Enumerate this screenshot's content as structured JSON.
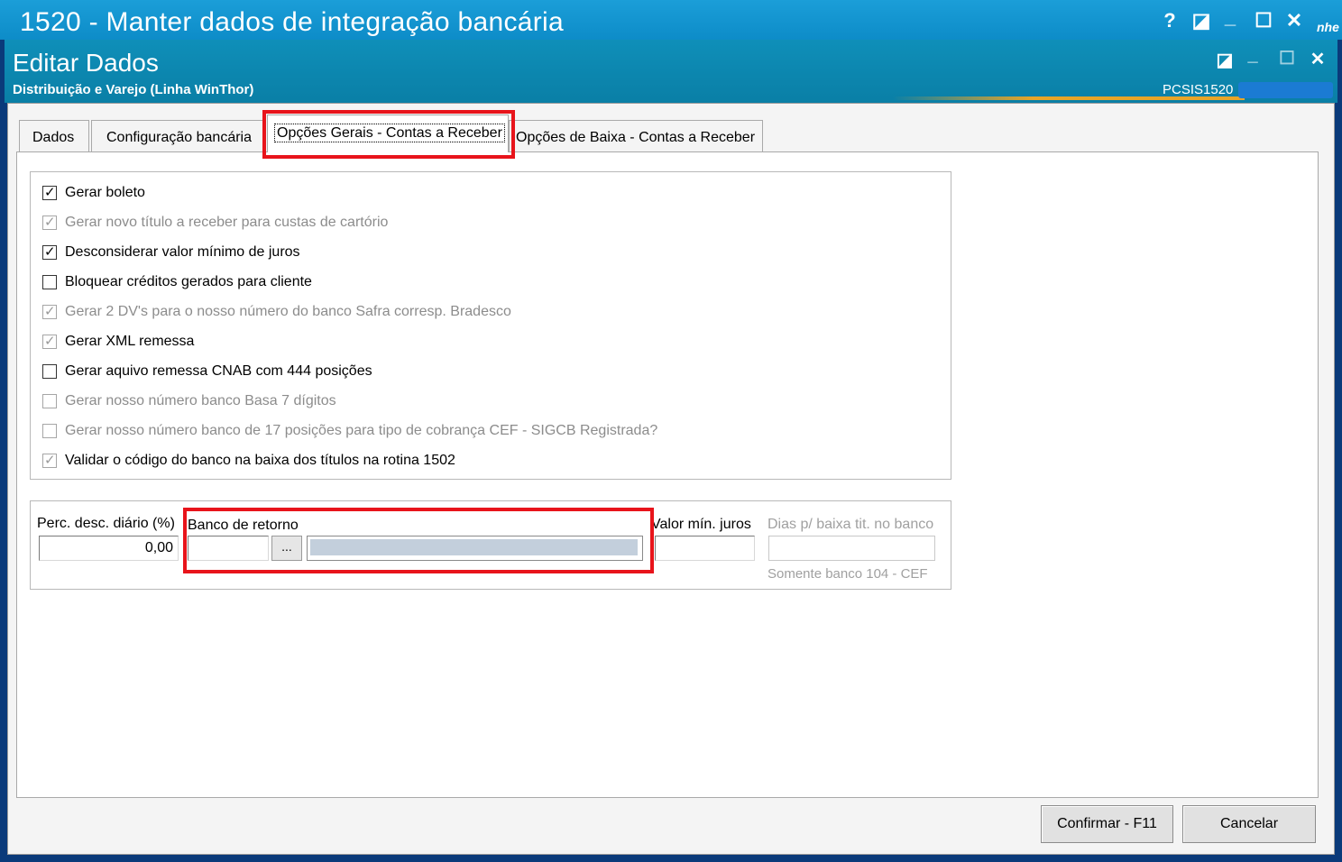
{
  "window": {
    "title": "1520 - Manter dados de integração bancária",
    "help_label": "?",
    "restore_label": "◪",
    "minimize_label": "_",
    "maximize_label": "☐",
    "close_label": "✕",
    "side_text": "nhe"
  },
  "header": {
    "title": "Editar Dados",
    "subtitle": "Distribuição e Varejo (Linha WinThor)",
    "code": "PCSIS1520"
  },
  "tabs": [
    {
      "label": "Dados",
      "active": false
    },
    {
      "label": "Configuração bancária",
      "active": false
    },
    {
      "label": "Opções Gerais - Contas a Receber",
      "active": true
    },
    {
      "label": "Opções de Baixa - Contas a Receber",
      "active": false
    }
  ],
  "checkboxes": [
    {
      "label": "Gerar boleto",
      "checked": true,
      "enabled": true
    },
    {
      "label": "Gerar novo título a receber para custas de cartório",
      "checked": true,
      "enabled": false
    },
    {
      "label": "Desconsiderar valor mínimo de juros",
      "checked": true,
      "enabled": true
    },
    {
      "label": "Bloquear créditos gerados para cliente",
      "checked": false,
      "enabled": true
    },
    {
      "label": "Gerar 2 DV's para o nosso número do banco Safra corresp. Bradesco",
      "checked": true,
      "enabled": false
    },
    {
      "label": "Gerar XML remessa",
      "checked": true,
      "enabled": true
    },
    {
      "label": "Gerar aquivo remessa CNAB com 444 posições",
      "checked": false,
      "enabled": true
    },
    {
      "label": "Gerar nosso número banco Basa 7 dígitos",
      "checked": false,
      "enabled": false
    },
    {
      "label": "Gerar nosso número banco de 17 posições para tipo de cobrança CEF - SIGCB Registrada?",
      "checked": false,
      "enabled": false
    },
    {
      "label": "Validar o código do banco na baixa dos títulos na rotina 1502",
      "checked": true,
      "enabled": true
    }
  ],
  "fields": {
    "perc_label": "Perc. desc. diário (%)",
    "perc_value": "0,00",
    "banco_label": "Banco de retorno",
    "banco_value": "",
    "banco_button": "...",
    "juros_label": "Valor mín. juros",
    "juros_value": "",
    "dias_label": "Dias p/ baixa tit. no banco",
    "dias_value": "",
    "dias_hint": "Somente banco 104 - CEF"
  },
  "buttons": {
    "confirm": "Confirmar - F11",
    "cancel": "Cancelar"
  },
  "colors": {
    "title_bar": "#0d8cc8",
    "header": "#0a7fa6",
    "highlight": "#e8141b"
  }
}
